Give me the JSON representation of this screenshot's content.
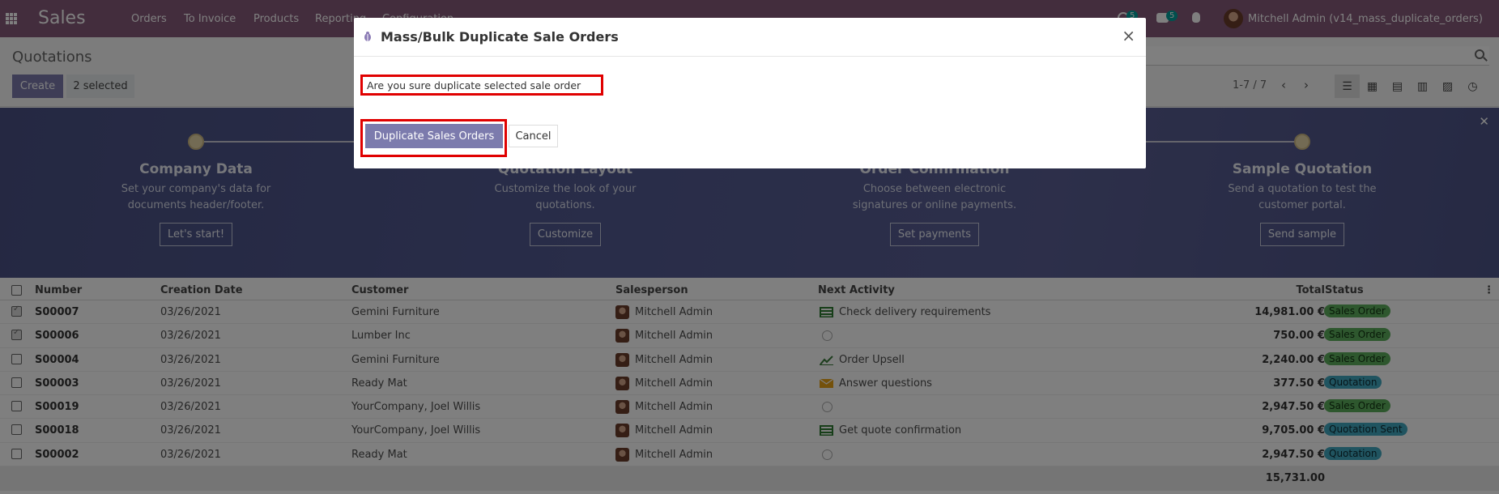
{
  "navbar": {
    "brand": "Sales",
    "menu": [
      "Orders",
      "To Invoice",
      "Products",
      "Reporting",
      "Configuration"
    ],
    "chat_count": "5",
    "activity_count": "5",
    "user": "Mitchell Admin (v14_mass_duplicate_orders)"
  },
  "control_panel": {
    "breadcrumb": "Quotations",
    "create_label": "Create",
    "selected_label": "2 selected",
    "pager": "1-7 / 7"
  },
  "banner": {
    "steps": [
      {
        "title": "Company Data",
        "desc1": "Set your company's data for",
        "desc2": "documents header/footer.",
        "button": "Let's start!"
      },
      {
        "title": "Quotation Layout",
        "desc1": "Customize the look of your",
        "desc2": "quotations.",
        "button": "Customize"
      },
      {
        "title": "Order Confirmation",
        "desc1": "Choose between electronic",
        "desc2": "signatures or online payments.",
        "button": "Set payments"
      },
      {
        "title": "Sample Quotation",
        "desc1": "Send a quotation to test the",
        "desc2": "customer portal.",
        "button": "Send sample"
      }
    ]
  },
  "table": {
    "headers": {
      "number": "Number",
      "creation_date": "Creation Date",
      "customer": "Customer",
      "salesperson": "Salesperson",
      "next_activity": "Next Activity",
      "total": "Total",
      "status": "Status"
    },
    "rows": [
      {
        "number": "S00007",
        "date": "03/26/2021",
        "customer": "Gemini Furniture",
        "salesperson": "Mitchell Admin",
        "activity": "Check delivery requirements",
        "activity_icon": "list-icon",
        "total": "14,981.00 €",
        "status": "Sales Order",
        "checked": true
      },
      {
        "number": "S00006",
        "date": "03/26/2021",
        "customer": "Lumber Inc",
        "salesperson": "Mitchell Admin",
        "activity": "",
        "activity_icon": "clock-icon",
        "total": "750.00 €",
        "status": "Sales Order",
        "checked": true
      },
      {
        "number": "S00004",
        "date": "03/26/2021",
        "customer": "Gemini Furniture",
        "salesperson": "Mitchell Admin",
        "activity": "Order Upsell",
        "activity_icon": "chart-icon",
        "total": "2,240.00 €",
        "status": "Sales Order",
        "checked": false
      },
      {
        "number": "S00003",
        "date": "03/26/2021",
        "customer": "Ready Mat",
        "salesperson": "Mitchell Admin",
        "activity": "Answer questions",
        "activity_icon": "envelope-icon",
        "total": "377.50 €",
        "status": "Quotation",
        "checked": false
      },
      {
        "number": "S00019",
        "date": "03/26/2021",
        "customer": "YourCompany, Joel Willis",
        "salesperson": "Mitchell Admin",
        "activity": "",
        "activity_icon": "clock-icon",
        "total": "2,947.50 €",
        "status": "Sales Order",
        "checked": false
      },
      {
        "number": "S00018",
        "date": "03/26/2021",
        "customer": "YourCompany, Joel Willis",
        "salesperson": "Mitchell Admin",
        "activity": "Get quote confirmation",
        "activity_icon": "list-icon",
        "total": "9,705.00 €",
        "status": "Quotation Sent",
        "checked": false
      },
      {
        "number": "S00002",
        "date": "03/26/2021",
        "customer": "Ready Mat",
        "salesperson": "Mitchell Admin",
        "activity": "",
        "activity_icon": "clock-icon",
        "total": "2,947.50 €",
        "status": "Quotation",
        "checked": false
      }
    ],
    "footer_total": "15,731.00"
  },
  "modal": {
    "title": "Mass/Bulk Duplicate Sale Orders",
    "message": "Are you sure duplicate selected sale order",
    "duplicate_label": "Duplicate Sales Orders",
    "cancel_label": "Cancel",
    "close_symbol": "×"
  },
  "colors": {
    "navbar": "#875a7b",
    "primary_button": "#7c7bad",
    "highlight": "#e00000",
    "badge_sales_order": "#5dae5d",
    "badge_quotation": "#41a8c0"
  }
}
